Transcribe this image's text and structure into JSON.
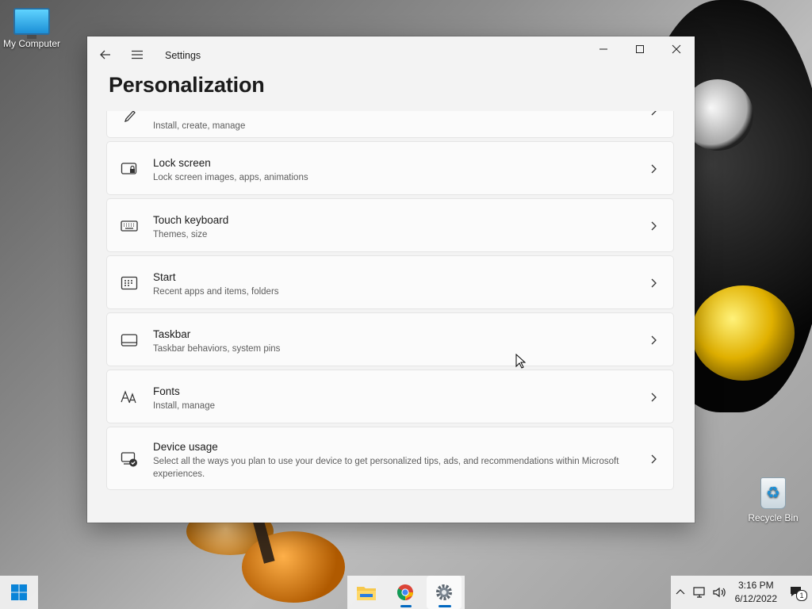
{
  "desktop": {
    "icons": [
      {
        "label": "My Computer",
        "icon": "computer-icon"
      },
      {
        "label": "Recycle Bin",
        "icon": "recycle-bin-icon"
      }
    ]
  },
  "window": {
    "app_title": "Settings",
    "page_title": "Personalization",
    "controls": {
      "minimize": "minimize-icon",
      "maximize": "maximize-icon",
      "close": "close-icon"
    }
  },
  "items": [
    {
      "title": "",
      "subtitle": "Install, create, manage",
      "icon": "brush-icon"
    },
    {
      "title": "Lock screen",
      "subtitle": "Lock screen images, apps, animations",
      "icon": "lock-screen-icon"
    },
    {
      "title": "Touch keyboard",
      "subtitle": "Themes, size",
      "icon": "keyboard-icon"
    },
    {
      "title": "Start",
      "subtitle": "Recent apps and items, folders",
      "icon": "start-icon"
    },
    {
      "title": "Taskbar",
      "subtitle": "Taskbar behaviors, system pins",
      "icon": "taskbar-icon"
    },
    {
      "title": "Fonts",
      "subtitle": "Install, manage",
      "icon": "fonts-icon"
    },
    {
      "title": "Device usage",
      "subtitle": "Select all the ways you plan to use your device to get personalized tips, ads, and recommendations within Microsoft experiences.",
      "icon": "device-usage-icon"
    }
  ],
  "taskbar": {
    "apps": [
      "start-icon",
      "file-explorer-icon",
      "chrome-icon",
      "settings-icon"
    ],
    "clock": {
      "time": "3:16 PM",
      "date": "6/12/2022"
    },
    "notification_count": "1",
    "colors": {
      "accent": "#0067c0",
      "window_bg": "#f3f3f3",
      "card_bg": "#fbfbfb"
    }
  }
}
